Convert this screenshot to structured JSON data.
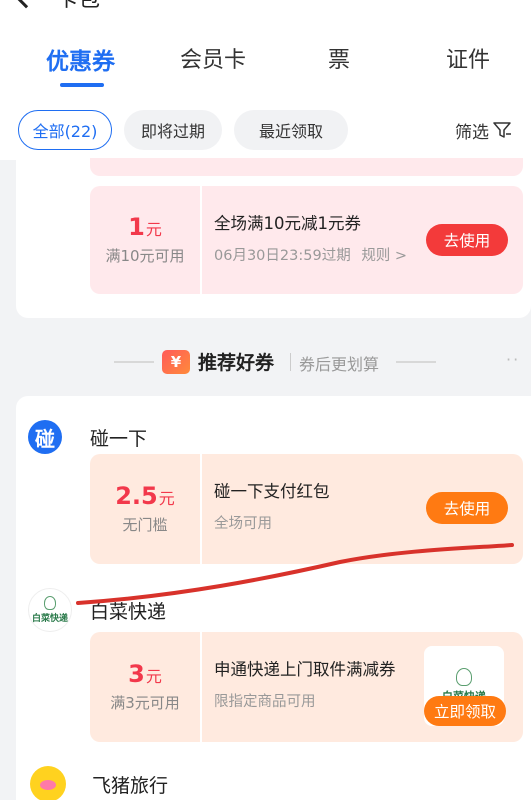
{
  "header": {
    "back_title": "卡包",
    "tabs": [
      {
        "label": "优惠券",
        "active": true
      },
      {
        "label": "会员卡",
        "active": false
      },
      {
        "label": "票",
        "active": false
      },
      {
        "label": "证件",
        "active": false
      }
    ],
    "chips": [
      {
        "label": "全部(22)",
        "active": true
      },
      {
        "label": "即将过期",
        "active": false
      },
      {
        "label": "最近领取",
        "active": false
      }
    ],
    "filter_label": "筛选"
  },
  "top_coupon": {
    "amount": "1",
    "unit": "元",
    "condition": "满10元可用",
    "title": "全场满10元减1元券",
    "expiry": "06月30日23:59过期",
    "rules": "规则 >",
    "button": "去使用"
  },
  "recommended": {
    "icon_glyph": "¥",
    "title": "推荐好券",
    "subtitle": "券后更划算",
    "dots": "··"
  },
  "brands": [
    {
      "name": "碰一下",
      "logo_glyph": "碰",
      "coupon": {
        "amount": "2.5",
        "unit": "元",
        "condition": "无门槛",
        "title": "碰一下支付红包",
        "subtitle": "全场可用",
        "button": "去使用"
      }
    },
    {
      "name": "白菜快递",
      "logo_text": "白菜快递",
      "coupon": {
        "amount": "3",
        "unit": "元",
        "condition": "满3元可用",
        "title": "申通快递上门取件满减券",
        "subtitle": "限指定商品可用",
        "thumb_text": "白菜快递",
        "button": "立即领取"
      }
    },
    {
      "name": "飞猪旅行"
    }
  ],
  "colors": {
    "accent_blue": "#1f6ef2",
    "price_red": "#f2384b",
    "button_red": "#f33a3a",
    "button_orange": "#ff7a12",
    "annotation_stroke": "#d8322b"
  }
}
